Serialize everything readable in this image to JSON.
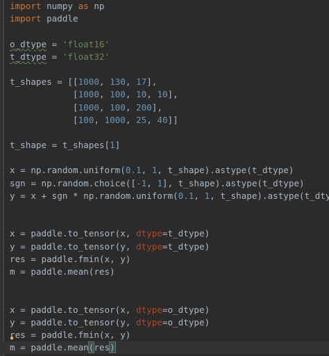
{
  "lines": [
    [
      {
        "t": "import",
        "c": "kw"
      },
      {
        "t": " numpy ",
        "c": "txt"
      },
      {
        "t": "as",
        "c": "kw"
      },
      {
        "t": " np",
        "c": "txt"
      }
    ],
    [
      {
        "t": "import",
        "c": "kw"
      },
      {
        "t": " paddle",
        "c": "txt"
      }
    ],
    [],
    [
      {
        "t": "o_dtype",
        "c": "txt dtype-typo"
      },
      {
        "t": " = ",
        "c": "txt"
      },
      {
        "t": "'float16'",
        "c": "str"
      }
    ],
    [
      {
        "t": "t_dtype",
        "c": "txt dtype-typo"
      },
      {
        "t": " = ",
        "c": "txt"
      },
      {
        "t": "'float32'",
        "c": "str"
      }
    ],
    [],
    [
      {
        "t": "t_shapes = [[",
        "c": "txt"
      },
      {
        "t": "1000",
        "c": "num"
      },
      {
        "t": ", ",
        "c": "txt"
      },
      {
        "t": "130",
        "c": "num"
      },
      {
        "t": ", ",
        "c": "txt"
      },
      {
        "t": "17",
        "c": "num"
      },
      {
        "t": "],",
        "c": "txt"
      }
    ],
    [
      {
        "t": "            [",
        "c": "txt"
      },
      {
        "t": "1000",
        "c": "num"
      },
      {
        "t": ", ",
        "c": "txt"
      },
      {
        "t": "100",
        "c": "num"
      },
      {
        "t": ", ",
        "c": "txt"
      },
      {
        "t": "10",
        "c": "num"
      },
      {
        "t": ", ",
        "c": "txt"
      },
      {
        "t": "10",
        "c": "num"
      },
      {
        "t": "],",
        "c": "txt"
      }
    ],
    [
      {
        "t": "            [",
        "c": "txt"
      },
      {
        "t": "1000",
        "c": "num"
      },
      {
        "t": ", ",
        "c": "txt"
      },
      {
        "t": "100",
        "c": "num"
      },
      {
        "t": ", ",
        "c": "txt"
      },
      {
        "t": "200",
        "c": "num"
      },
      {
        "t": "],",
        "c": "txt"
      }
    ],
    [
      {
        "t": "            [",
        "c": "txt"
      },
      {
        "t": "100",
        "c": "num"
      },
      {
        "t": ", ",
        "c": "txt"
      },
      {
        "t": "1000",
        "c": "num"
      },
      {
        "t": ", ",
        "c": "txt"
      },
      {
        "t": "25",
        "c": "num"
      },
      {
        "t": ", ",
        "c": "txt"
      },
      {
        "t": "40",
        "c": "num"
      },
      {
        "t": "]]",
        "c": "txt"
      }
    ],
    [],
    [
      {
        "t": "t_shape = t_shapes[",
        "c": "txt"
      },
      {
        "t": "1",
        "c": "num"
      },
      {
        "t": "]",
        "c": "txt"
      }
    ],
    [],
    [
      {
        "t": "x = np.random.uniform(",
        "c": "txt"
      },
      {
        "t": "0.1",
        "c": "num"
      },
      {
        "t": ", ",
        "c": "txt"
      },
      {
        "t": "1",
        "c": "num"
      },
      {
        "t": ", t_shape).astype(t_dtype)",
        "c": "txt"
      }
    ],
    [
      {
        "t": "sgn = np.random.choice([",
        "c": "txt"
      },
      {
        "t": "-1",
        "c": "num"
      },
      {
        "t": ", ",
        "c": "txt"
      },
      {
        "t": "1",
        "c": "num"
      },
      {
        "t": "], t_shape).astype(t_dtype)",
        "c": "txt"
      }
    ],
    [
      {
        "t": "y = x + sgn * np.random.uniform(",
        "c": "txt"
      },
      {
        "t": "0.1",
        "c": "num"
      },
      {
        "t": ", ",
        "c": "txt"
      },
      {
        "t": "1",
        "c": "num"
      },
      {
        "t": ", t_shape).astype(t_dtype)",
        "c": "txt"
      }
    ],
    [],
    [],
    [
      {
        "t": "x = paddle.to_tensor(x, ",
        "c": "txt"
      },
      {
        "t": "dtype",
        "c": "kwarg"
      },
      {
        "t": "=t_dtype)",
        "c": "txt"
      }
    ],
    [
      {
        "t": "y = paddle.to_tensor(y, ",
        "c": "txt"
      },
      {
        "t": "dtype",
        "c": "kwarg"
      },
      {
        "t": "=t_dtype)",
        "c": "txt"
      }
    ],
    [
      {
        "t": "res = paddle.fmin(x, y)",
        "c": "txt"
      }
    ],
    [
      {
        "t": "m = paddle.mean(res)",
        "c": "txt"
      }
    ],
    [],
    [],
    [
      {
        "t": "x = paddle.to_tensor(x, ",
        "c": "txt"
      },
      {
        "t": "dtype",
        "c": "kwarg"
      },
      {
        "t": "=o_dtype)",
        "c": "txt"
      }
    ],
    [
      {
        "t": "y = paddle.to_tensor(y, ",
        "c": "txt"
      },
      {
        "t": "dtype",
        "c": "kwarg"
      },
      {
        "t": "=o_dtype)",
        "c": "txt"
      }
    ],
    [
      {
        "t": "res = paddle.fmin(x, y)",
        "c": "txt"
      }
    ],
    [
      {
        "t": "m = paddle.mean",
        "c": "txt"
      },
      {
        "t": "(",
        "c": "txt brace-match"
      },
      {
        "t": "res",
        "c": "txt"
      },
      {
        "t": ")",
        "c": "txt brace-match"
      },
      {
        "t": "",
        "c": "caret"
      }
    ]
  ],
  "current_line": 27,
  "bulb_line": 26,
  "icons": {
    "intention": "lightbulb-icon"
  },
  "colors": {
    "background": "#2b2b2b",
    "keyword": "#cc7832",
    "string": "#6a8759",
    "number": "#6897bb",
    "kwarg": "#aa4926",
    "text": "#a9b7c6"
  }
}
